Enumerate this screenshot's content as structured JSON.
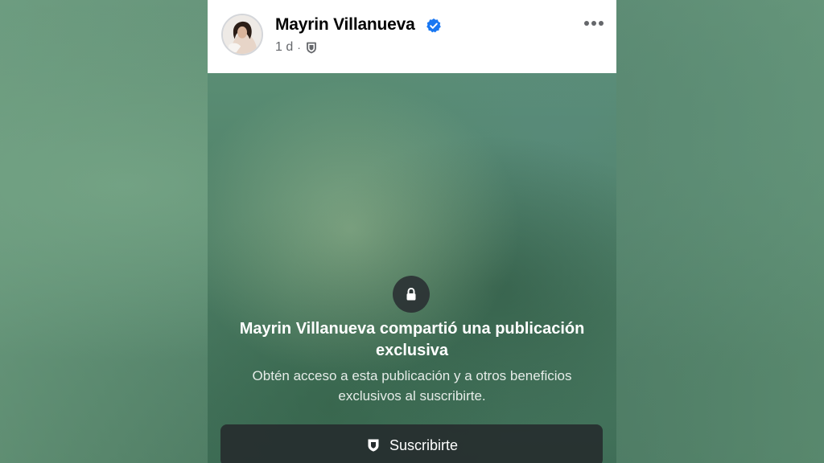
{
  "post": {
    "author": "Mayrin Villanueva",
    "verified": true,
    "time": "1 d",
    "separator": "·",
    "audience_icon": "shield-icon",
    "more_icon": "more-horizontal-icon"
  },
  "locked": {
    "lock_icon": "lock-icon",
    "title": "Mayrin Villanueva compartió una publicación exclusiva",
    "description": "Obtén acceso a esta publicación y a otros beneficios exclusivos al suscribirte.",
    "button_label": "Suscribirte",
    "button_icon": "shield-icon"
  },
  "colors": {
    "verified_blue": "#1877f2",
    "header_bg": "#ffffff",
    "button_bg": "#262c2e",
    "blurred_green": "#5a8d74"
  }
}
